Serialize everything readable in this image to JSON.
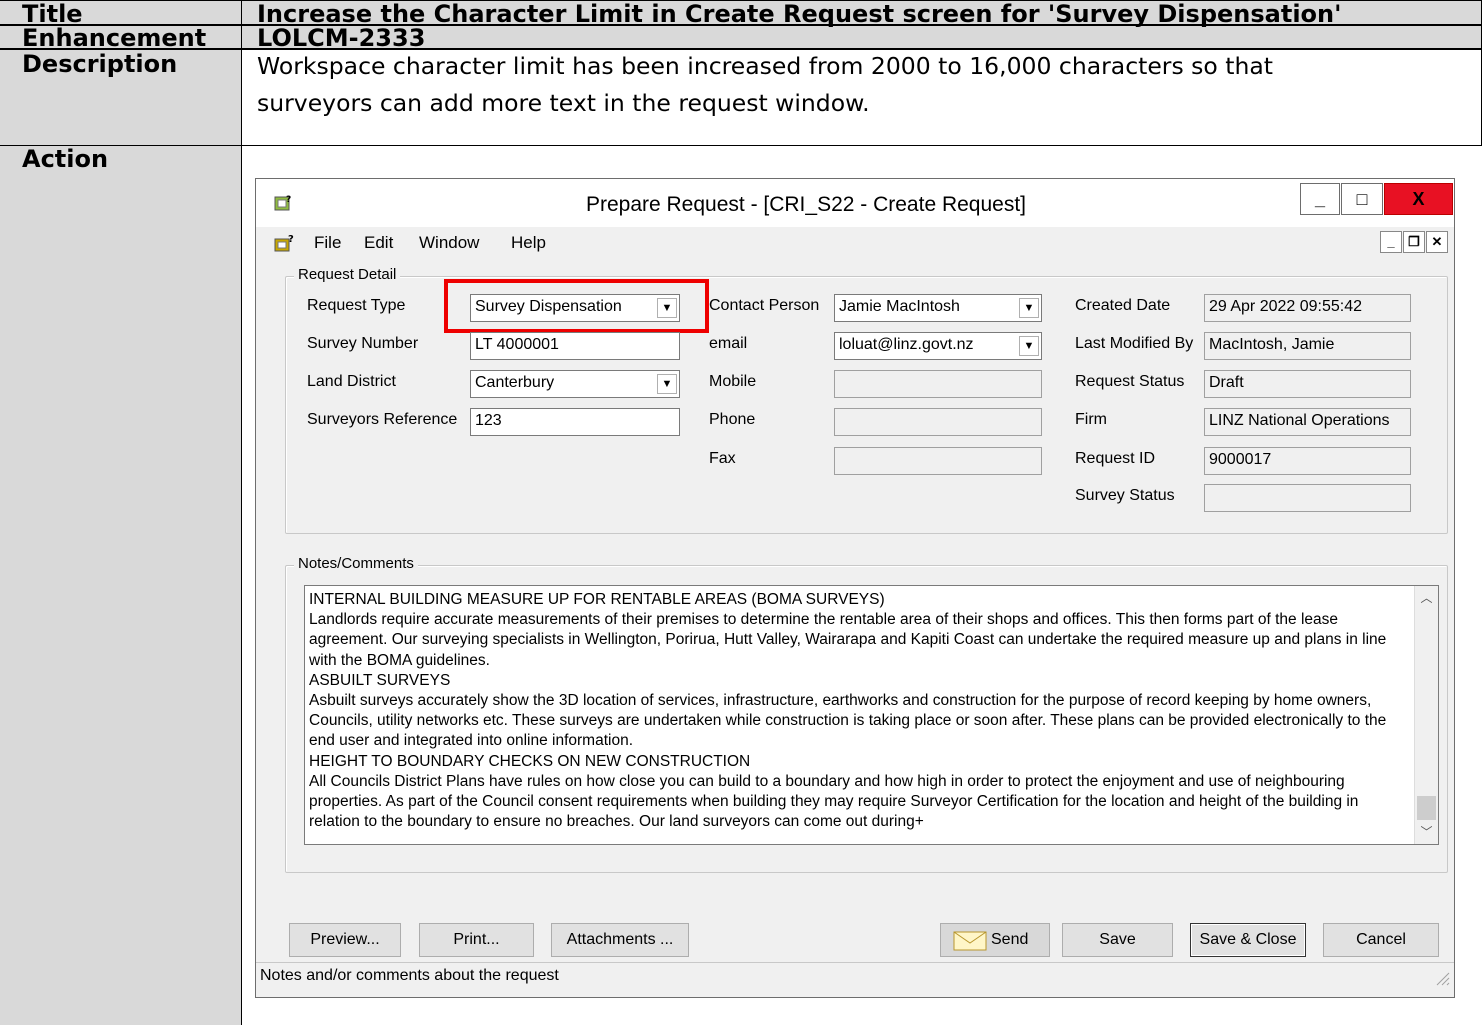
{
  "document": {
    "rows": [
      {
        "label": "Title",
        "value": "Increase the Character Limit in Create Request screen for 'Survey Dispensation'"
      },
      {
        "label": "Enhancement",
        "value": "LOLCM-2333"
      },
      {
        "label": "Description",
        "value_line1": "Workspace character limit has been increased from 2000 to 16,000 characters so that",
        "value_line2": "surveyors can add more text in the request window."
      },
      {
        "label": "Action"
      }
    ]
  },
  "window": {
    "title": "Prepare Request - [CRI_S22 - Create Request]",
    "controls": {
      "minimize": "_",
      "maximize": "□",
      "close": "X"
    },
    "menu": [
      "File",
      "Edit",
      "Window",
      "Help"
    ],
    "mdi_controls": [
      "_",
      "❐",
      "✕"
    ]
  },
  "request_detail": {
    "legend": "Request Detail",
    "request_type_label": "Request Type",
    "request_type_value": "Survey Dispensation",
    "survey_number_label": "Survey Number",
    "survey_number_value": "LT 4000001",
    "land_district_label": "Land District",
    "land_district_value": "Canterbury",
    "surveyors_reference_label": "Surveyors Reference",
    "surveyors_reference_value": "123",
    "contact_person_label": "Contact Person",
    "contact_person_value": "Jamie MacIntosh",
    "email_label": "email",
    "email_value": "loluat@linz.govt.nz",
    "mobile_label": "Mobile",
    "phone_label": "Phone",
    "fax_label": "Fax",
    "created_date_label": "Created Date",
    "created_date_value": "29 Apr 2022 09:55:42",
    "last_modified_label": "Last Modified By",
    "last_modified_value": "MacIntosh, Jamie",
    "request_status_label": "Request Status",
    "request_status_value": "Draft",
    "firm_label": "Firm",
    "firm_value": "LINZ National Operations",
    "request_id_label": "Request ID",
    "request_id_value": "9000017",
    "survey_status_label": "Survey Status"
  },
  "notes": {
    "legend": "Notes/Comments",
    "text": "INTERNAL BUILDING MEASURE UP FOR RENTABLE AREAS (BOMA SURVEYS)\nLandlords require accurate measurements of their premises to determine the rentable area of their shops and offices. This then forms part of the lease agreement. Our surveying specialists in Wellington, Porirua, Hutt Valley, Wairarapa and Kapiti Coast can undertake the required measure up and plans in line with the BOMA guidelines.\nASBUILT SURVEYS\nAsbuilt surveys accurately show the 3D location of services, infrastructure, earthworks and construction for the purpose of record keeping by home owners, Councils, utility networks etc. These surveys are undertaken while construction is taking place or soon after. These plans can be provided electronically to the end user and integrated into online information.\nHEIGHT TO BOUNDARY CHECKS ON NEW CONSTRUCTION\nAll Councils District Plans have rules on how close you can build to a boundary and how high in order to protect the enjoyment and use of neighbouring properties. As part of the Council consent requirements when building they may require Surveyor Certification for the location and height of the building in relation to the boundary to ensure no breaches. Our land surveyors can come out during+"
  },
  "buttons": {
    "preview": "Preview...",
    "print": "Print...",
    "attachments": "Attachments ...",
    "send": "Send",
    "save": "Save",
    "save_close": "Save & Close",
    "cancel": "Cancel"
  },
  "status_bar": {
    "text": "Notes and/or comments about the request"
  },
  "colors": {
    "highlight": "#e00000",
    "header_bg": "#d9d9d9",
    "close_btn": "#e81123"
  }
}
